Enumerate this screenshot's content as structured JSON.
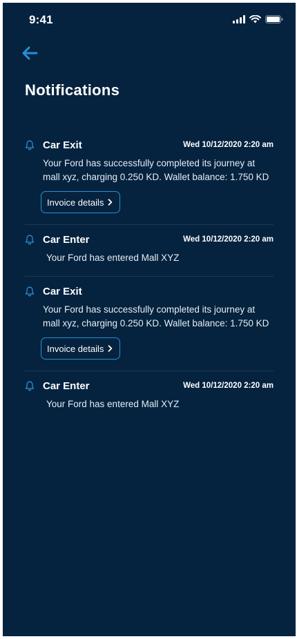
{
  "status_bar": {
    "time": "9:41"
  },
  "header": {
    "title": "Notifications"
  },
  "colors": {
    "background": "#05233f",
    "accent": "#2a8fd8",
    "divider": "#1c3a57"
  },
  "icons": {
    "back": "arrow-left-icon",
    "bell": "bell-icon",
    "chevron": "chevron-right-icon"
  },
  "notifications": [
    {
      "title": "Car Exit",
      "time": "Wed 10/12/2020 2:20 am",
      "message": "Your Ford has successfully completed its journey at mall xyz, charging 0.250 KD. Wallet balance: 1.750 KD",
      "action_label": "Invoice details"
    },
    {
      "title": "Car Enter",
      "time": "Wed 10/12/2020 2:20 am",
      "message": "Your Ford has entered Mall XYZ"
    },
    {
      "title": "Car Exit",
      "time": "",
      "message": "Your Ford has successfully completed its journey at mall xyz, charging 0.250 KD. Wallet balance: 1.750 KD",
      "action_label": "Invoice details"
    },
    {
      "title": "Car Enter",
      "time": "Wed 10/12/2020 2:20 am",
      "message": "Your Ford has entered Mall XYZ"
    }
  ]
}
